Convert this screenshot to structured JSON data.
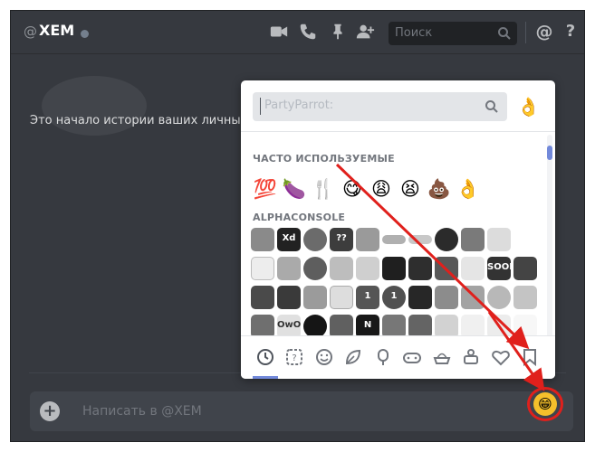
{
  "header": {
    "at_symbol": "@",
    "username": "XEM",
    "search_placeholder": "Поиск",
    "help_symbol": "?",
    "mention_symbol": "@",
    "icons": [
      "video-icon",
      "phone-icon",
      "pin-icon",
      "add-user-icon",
      "search-icon",
      "mention-icon",
      "help-icon"
    ]
  },
  "messages": {
    "start_text": "Это начало истории ваших личных"
  },
  "message_bar": {
    "plus": "+",
    "placeholder": "Написать в @XEM",
    "emoji_button": "😁"
  },
  "emoji_picker": {
    "search_placeholder": "PartyParrot:",
    "preview_emoji": "👌",
    "frequent_title": "ЧАСТО ИСПОЛЬЗУЕМЫЕ",
    "frequent": [
      "💯",
      "🍆",
      "🍴",
      "😋",
      "😩",
      "😫",
      "💩",
      "👌"
    ],
    "custom_title": "ALPHACONSOLE",
    "custom_labels": [
      "Xd",
      "??",
      "SOON",
      "1",
      "1",
      "OwO",
      "N"
    ],
    "tabs": [
      "recent-icon",
      "custom-icon",
      "people-icon",
      "nature-icon",
      "food-icon",
      "activity-icon",
      "travel-icon",
      "objects-icon",
      "symbols-icon",
      "flags-icon"
    ]
  },
  "colors": {
    "background": "#36393f",
    "accent": "#7289da",
    "annotation_red": "#e0201c",
    "emoji_yellow": "#f5c02b"
  }
}
